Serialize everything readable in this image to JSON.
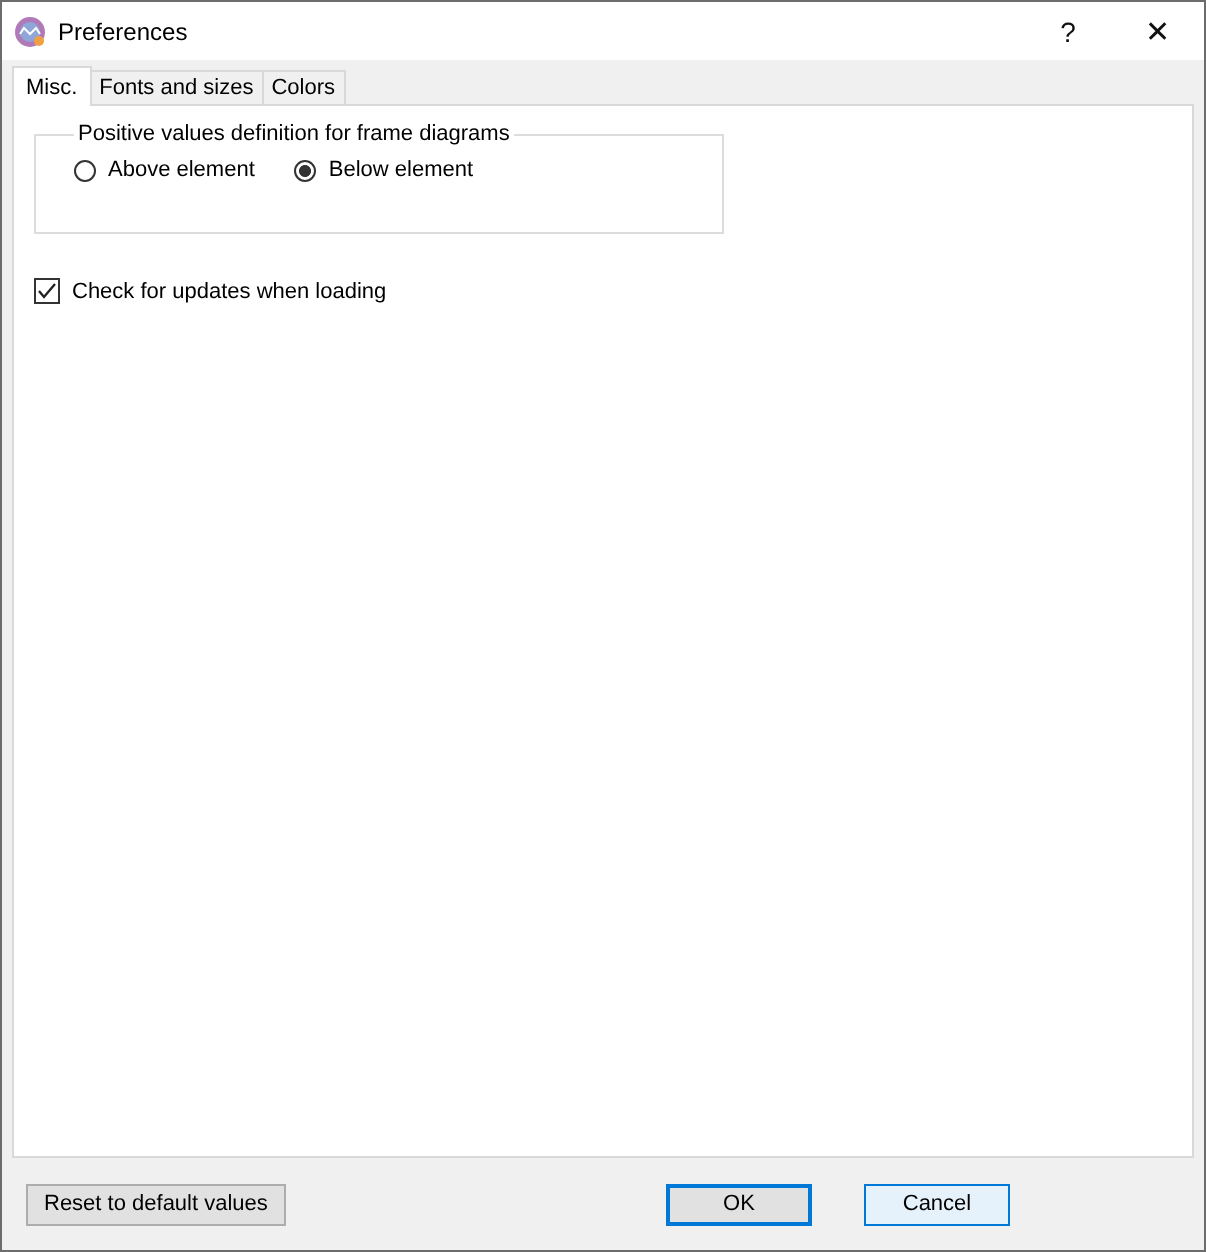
{
  "window": {
    "title": "Preferences",
    "help": "?",
    "close": "✕"
  },
  "tabs": [
    {
      "label": "Misc.",
      "selected": true
    },
    {
      "label": "Fonts and sizes",
      "selected": false
    },
    {
      "label": "Colors",
      "selected": false
    }
  ],
  "group": {
    "title": "Positive values definition for frame diagrams",
    "options": [
      {
        "label": "Above element",
        "selected": false
      },
      {
        "label": "Below element",
        "selected": true
      }
    ]
  },
  "checkbox": {
    "label": "Check for updates when loading",
    "checked": true
  },
  "reset_button": "Reset to default values",
  "buttons": [
    {
      "label": "OK",
      "default": true,
      "hovered": false
    },
    {
      "label": "Cancel",
      "default": false,
      "hovered": true
    }
  ]
}
